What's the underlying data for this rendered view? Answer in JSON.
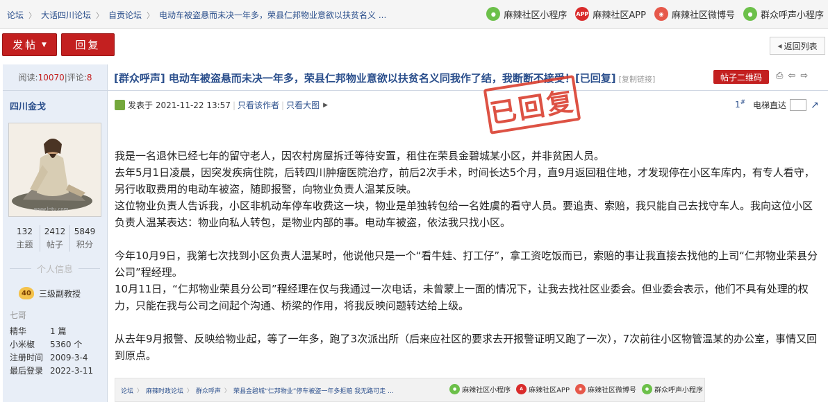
{
  "breadcrumb": [
    "论坛",
    "大话四川论坛",
    "自贡论坛",
    "电动车被盗悬而未决一年多，荣县仁邦物业意欲以扶贫名义 ..."
  ],
  "top_links": [
    {
      "label": "麻辣社区小程序",
      "icon": "wechat-miniprogram-icon"
    },
    {
      "label": "麻辣社区APP",
      "icon": "app-icon",
      "badge": "APP"
    },
    {
      "label": "麻辣社区微博号",
      "icon": "weibo-icon"
    },
    {
      "label": "群众呼声小程序",
      "icon": "wechat-miniprogram-icon"
    }
  ],
  "actions": {
    "post": "发帖",
    "reply": "回复",
    "back": "返回列表"
  },
  "stats_bar": {
    "views_label": "阅读:",
    "views": "10070",
    "sep": "|",
    "comments_label": "评论:",
    "comments": "8"
  },
  "thread": {
    "title": "[群众呼声] 电动车被盗悬而未决一年多，荣县仁邦物业意欲以扶贫名义同我作了结，我断断不接受！[已回复]",
    "copy_link": "[复制链接]",
    "qr_button": "帖子二维码",
    "stamp": "已回复"
  },
  "author": {
    "name": "四川金戈",
    "stats": [
      {
        "value": "132",
        "label": "主题"
      },
      {
        "value": "2412",
        "label": "帖子"
      },
      {
        "value": "5849",
        "label": "积分"
      }
    ],
    "personal_info_label": "个人信息",
    "level_badge": "40",
    "rank": "三级副教授",
    "nickname": "七哥",
    "meta": [
      {
        "key": "精华",
        "value": "1 篇"
      },
      {
        "key": "小米椒",
        "value": "5360 个"
      },
      {
        "key": "注册时间",
        "value": "2009-3-4"
      },
      {
        "key": "最后登录",
        "value": "2022-3-11"
      }
    ]
  },
  "post": {
    "posted_at": "发表于 2021-11-22 13:57",
    "only_author": "只看该作者",
    "only_large": "只看大图",
    "floor": "1",
    "floor_sup": "#",
    "elevator": "电梯直达",
    "paragraphs": [
      "我是一名退休已经七年的留守老人，因农村房屋拆迁等待安置，租住在荣县金碧城某小区，并非贫困人员。",
      "去年5月1日凌晨，因突发疾病住院，后转四川肿瘤医院治疗，前后2次手术，时间长达5个月，直9月返回租住地，才发现停在小区车库内，有专人看守，另行收取费用的电动车被盗，随即报警，向物业负责人温某反映。",
      "这位物业负责人告诉我，小区非机动车停车收费这一块，物业是单独转包给一名姓虞的看守人员。要追责、索赔，我只能自己去找守车人。我向这位小区负责人温某表达：物业向私人转包，是物业内部的事。电动车被盗，依法我只找小区。",
      "",
      "今年10月9日，我第七次找到小区负责人温某时，他说他只是一个“看牛娃、打工仔”，拿工资吃饭而已，索赔的事让我直接去找他的上司“仁邦物业荣县分公司”程经理。",
      "10月11日，“仁邦物业荣县分公司”程经理在仅与我通过一次电话，未曾蒙上一面的情况下，让我去找社区业委会。但业委会表示，他们不具有处理的权力，只能在我与公司之间起个沟通、桥梁的作用，将我反映问题转达给上级。",
      "",
      "从去年9月报警、反映给物业起，等了一年多，跑了3次派出所（后来应社区的要求去开报警证明又跑了一次），7次前往小区物管温某的办公室，事情又回到原点。"
    ]
  },
  "embedded_strip": {
    "breadcrumb": [
      "论坛",
      "麻辣时政论坛",
      "群众呼声",
      "荣县金碧城“仁邦物业”停车被盗一年多拒赔 我无路可走 ..."
    ],
    "links": [
      "麻辣社区小程序",
      "麻辣社区APP",
      "麻辣社区微博号",
      "群众呼声小程序"
    ]
  }
}
